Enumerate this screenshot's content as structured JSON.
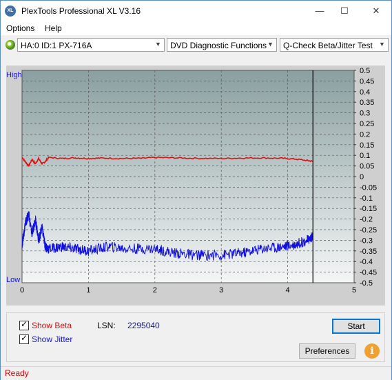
{
  "window": {
    "title": "PlexTools Professional XL V3.16",
    "icon_text": "XL"
  },
  "menu": [
    {
      "label": "Options",
      "access_key": "O"
    },
    {
      "label": "Help",
      "access_key": "H"
    }
  ],
  "toolbar": {
    "drive": "HA:0 ID:1  PX-716A",
    "function": "DVD Diagnostic Functions",
    "test": "Q-Check Beta/Jitter Test"
  },
  "chart": {
    "high_label": "High",
    "low_label": "Low",
    "colors": {
      "beta": "#e01010",
      "jitter": "#1010e0",
      "bg_top": "#8a9fa0",
      "bg_bottom": "#f4f6f6"
    }
  },
  "chart_data": {
    "type": "line",
    "x_ticks": [
      "0",
      "1",
      "2",
      "3",
      "4",
      "5"
    ],
    "xlim": [
      0,
      5
    ],
    "right_ticks": [
      "0.5",
      "0.45",
      "0.4",
      "0.35",
      "0.3",
      "0.25",
      "0.2",
      "0.15",
      "0.1",
      "0.05",
      "0",
      "-0.05",
      "-0.1",
      "-0.15",
      "-0.2",
      "-0.25",
      "-0.3",
      "-0.35",
      "-0.4",
      "-0.45",
      "-0.5"
    ],
    "ylim": [
      -0.5,
      0.5
    ],
    "end_marker_x": 4.38,
    "grid": true,
    "series": [
      {
        "name": "Beta",
        "x": [
          0.0,
          0.05,
          0.1,
          0.15,
          0.2,
          0.25,
          0.3,
          0.35,
          0.4,
          0.6,
          0.8,
          1.0,
          1.2,
          1.5,
          1.8,
          2.0,
          2.3,
          2.6,
          3.0,
          3.3,
          3.6,
          3.9,
          4.1,
          4.3,
          4.38
        ],
        "values": [
          0.09,
          0.07,
          0.05,
          0.08,
          0.06,
          0.085,
          0.06,
          0.07,
          0.09,
          0.085,
          0.088,
          0.085,
          0.087,
          0.085,
          0.086,
          0.09,
          0.088,
          0.086,
          0.085,
          0.087,
          0.088,
          0.086,
          0.083,
          0.075,
          0.072
        ]
      },
      {
        "name": "Jitter",
        "x": [
          0.0,
          0.05,
          0.1,
          0.15,
          0.2,
          0.25,
          0.3,
          0.35,
          0.4,
          0.6,
          0.8,
          1.0,
          1.3,
          1.6,
          2.0,
          2.3,
          2.6,
          3.0,
          3.3,
          3.6,
          3.9,
          4.1,
          4.3,
          4.38
        ],
        "values": [
          -0.32,
          -0.22,
          -0.18,
          -0.27,
          -0.2,
          -0.3,
          -0.24,
          -0.33,
          -0.34,
          -0.33,
          -0.34,
          -0.35,
          -0.33,
          -0.34,
          -0.34,
          -0.36,
          -0.37,
          -0.37,
          -0.36,
          -0.34,
          -0.33,
          -0.32,
          -0.3,
          -0.28
        ]
      }
    ]
  },
  "controls": {
    "show_beta": {
      "label": "Show Beta",
      "checked": true
    },
    "show_jitter": {
      "label": "Show Jitter",
      "checked": true
    },
    "lsn_label": "LSN:",
    "lsn_value": "2295040",
    "start": "Start",
    "preferences": "Preferences",
    "info": "i"
  },
  "status": "Ready"
}
